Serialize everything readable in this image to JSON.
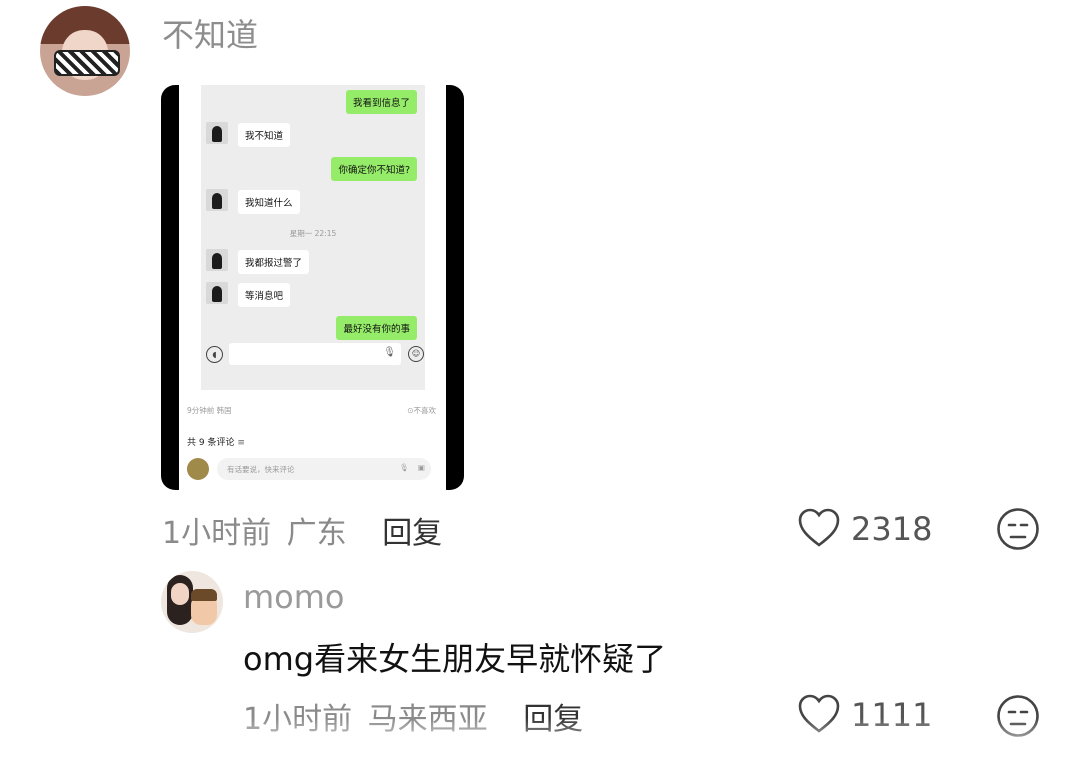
{
  "comment": {
    "text": "不知道",
    "meta_time": "1小时前",
    "meta_location": "广东",
    "reply_label": "回复",
    "like_count": "2318",
    "embedded_screenshot": {
      "messages": [
        {
          "side": "out",
          "text": "我看到信息了"
        },
        {
          "side": "in",
          "text": "我不知道"
        },
        {
          "side": "out",
          "text": "你确定你不知道?"
        },
        {
          "side": "in",
          "text": "我知道什么"
        },
        {
          "side": "in",
          "text": "我都报过警了"
        },
        {
          "side": "in",
          "text": "等消息吧"
        },
        {
          "side": "out",
          "text": "最好没有你的事"
        }
      ],
      "timestamp": "星期一 22:15",
      "post_meta": "9分钟前 韩国",
      "dislike_label": "不喜欢",
      "comments_count": "共 9 条评论",
      "comment_placeholder": "有话要说，快来评论"
    }
  },
  "reply": {
    "username": "momo",
    "text": "omg看来女生朋友早就怀疑了",
    "meta_time": "1小时前",
    "meta_location": "马来西亚",
    "reply_label": "回复",
    "like_count": "1111"
  }
}
